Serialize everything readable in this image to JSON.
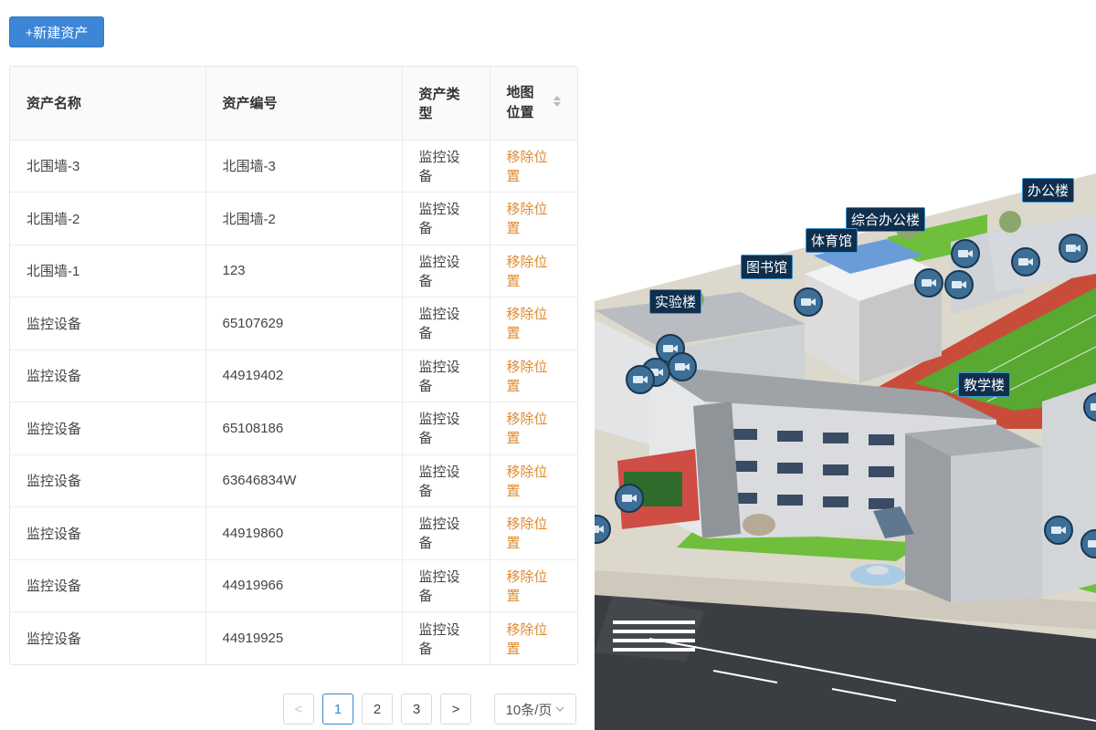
{
  "toolbar": {
    "new_asset_label": "+新建资产"
  },
  "table": {
    "columns": {
      "name": "资产名称",
      "code": "资产编号",
      "type": "资产类型",
      "location": "地图位置"
    },
    "rows": [
      {
        "name": "北围墙-3",
        "code": "北围墙-3",
        "type": "监控设备",
        "action": "移除位置"
      },
      {
        "name": "北围墙-2",
        "code": "北围墙-2",
        "type": "监控设备",
        "action": "移除位置"
      },
      {
        "name": "北围墙-1",
        "code": "123",
        "type": "监控设备",
        "action": "移除位置"
      },
      {
        "name": "监控设备",
        "code": "65107629",
        "type": "监控设备",
        "action": "移除位置"
      },
      {
        "name": "监控设备",
        "code": "44919402",
        "type": "监控设备",
        "action": "移除位置"
      },
      {
        "name": "监控设备",
        "code": "65108186",
        "type": "监控设备",
        "action": "移除位置"
      },
      {
        "name": "监控设备",
        "code": "63646834W",
        "type": "监控设备",
        "action": "移除位置"
      },
      {
        "name": "监控设备",
        "code": "44919860",
        "type": "监控设备",
        "action": "移除位置"
      },
      {
        "name": "监控设备",
        "code": "44919966",
        "type": "监控设备",
        "action": "移除位置"
      },
      {
        "name": "监控设备",
        "code": "44919925",
        "type": "监控设备",
        "action": "移除位置"
      }
    ]
  },
  "pagination": {
    "prev": "<",
    "next": ">",
    "pages": [
      "1",
      "2",
      "3"
    ],
    "current": "1",
    "page_size": "10条/页"
  },
  "map": {
    "labels": {
      "office": "办公楼",
      "comprehensive_office": "综合办公楼",
      "gym": "体育馆",
      "library": "图书馆",
      "lab": "实验楼",
      "teaching": "教学楼"
    },
    "camera_count": 15
  },
  "colors": {
    "primary": "#3d86d6",
    "link": "#e08a2e",
    "map_label_bg": "#0f2f4d",
    "camera": "#3d6f96",
    "field": "#58a832",
    "track": "#c94c3a"
  }
}
